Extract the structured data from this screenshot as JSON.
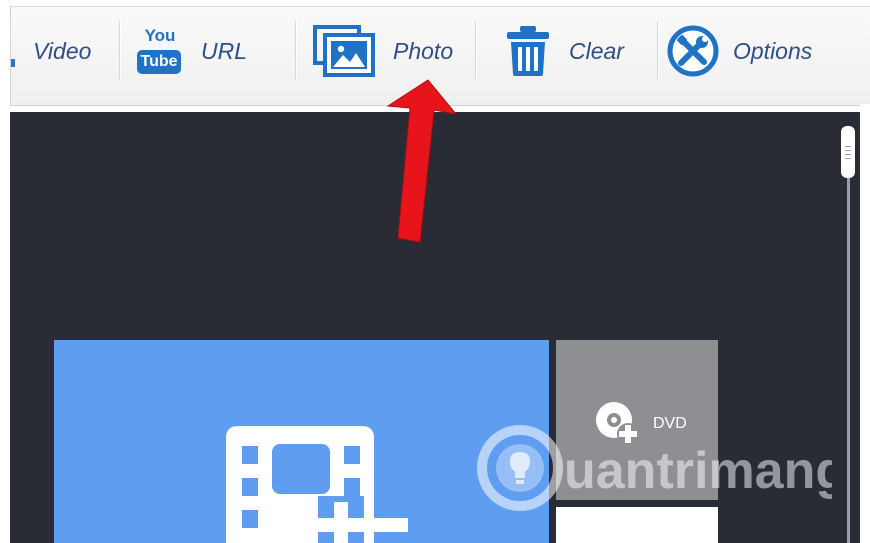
{
  "toolbar": {
    "video_label": "Video",
    "url_label": "URL",
    "photo_label": "Photo",
    "clear_label": "Clear",
    "options_label": "Options",
    "youtube_top": "You",
    "youtube_bottom": "Tube"
  },
  "dvd": {
    "label": "DVD"
  },
  "watermark": {
    "text": "uantrimang"
  },
  "colors": {
    "toolbar_text": "#2f4f86",
    "icon_blue": "#1f72c6",
    "workspace_bg": "#292c35",
    "video_tile": "#5f9df0",
    "dvd_tile": "#8d8f93",
    "arrow_red": "#e8141b"
  },
  "icons": [
    "youtube-icon",
    "photo-icon",
    "trash-icon",
    "tools-icon",
    "dvd-add-icon",
    "film-add-icon",
    "annotation-arrow"
  ]
}
